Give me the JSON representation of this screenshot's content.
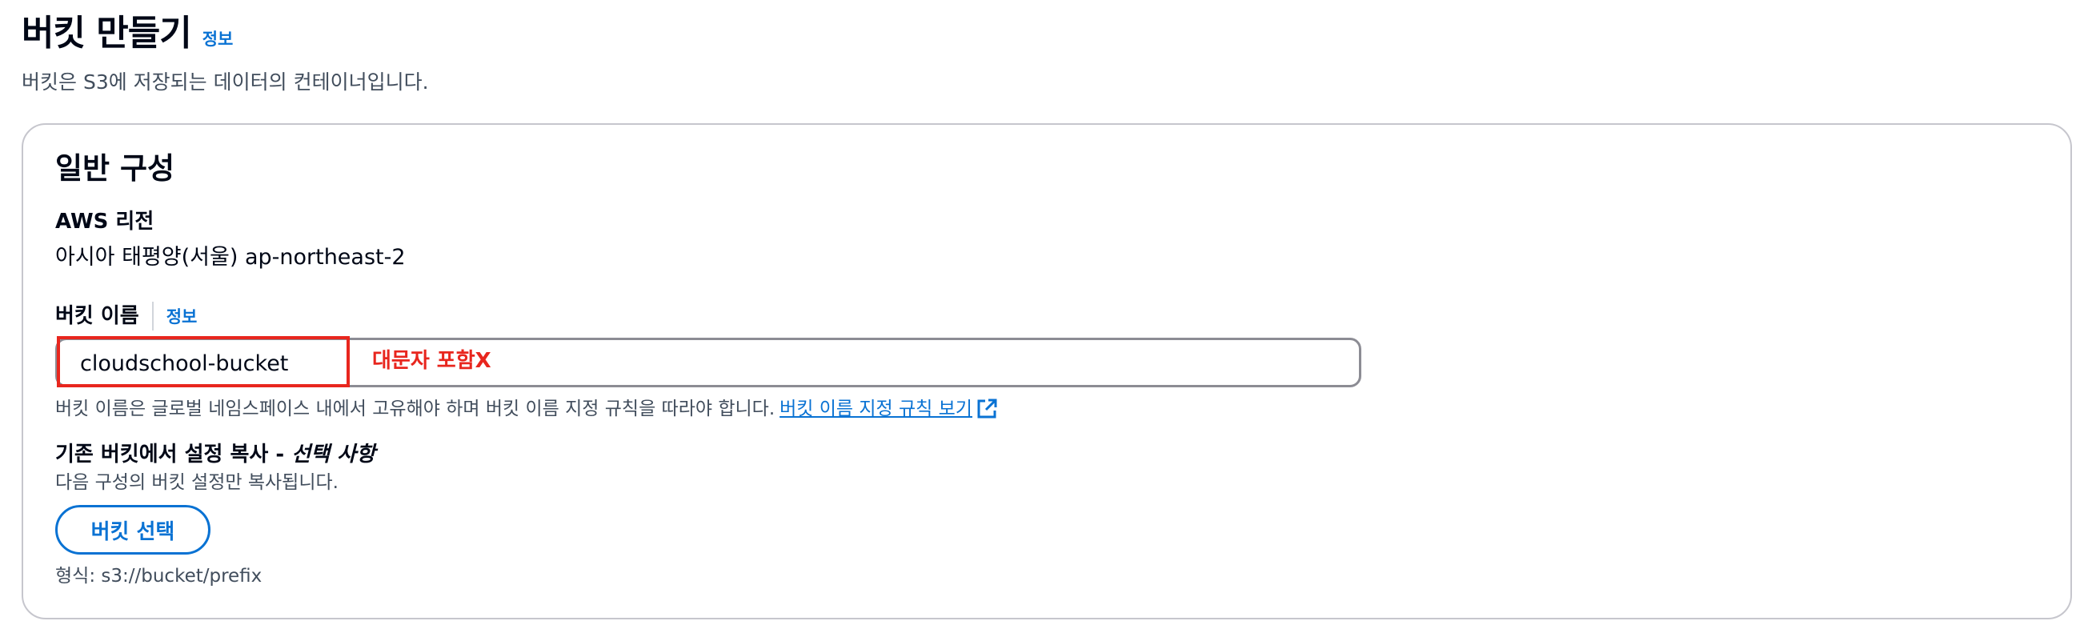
{
  "header": {
    "title": "버킷 만들기",
    "info_link": "정보",
    "description": "버킷은 S3에 저장되는 데이터의 컨테이너입니다."
  },
  "general": {
    "title": "일반 구성",
    "region_label": "AWS 리전",
    "region_value": "아시아 태평양(서울) ap-northeast-2",
    "bucket_name_label": "버킷 이름",
    "bucket_name_info": "정보",
    "bucket_name_value": "cloudschool-bucket",
    "annotation": "대문자 포함X",
    "bucket_name_hint": "버킷 이름은 글로벌 네임스페이스 내에서 고유해야 하며 버킷 이름 지정 규칙을 따라야 합니다.",
    "naming_rules_link": "버킷 이름 지정 규칙 보기",
    "copy_label": "기존 버킷에서 설정 복사 -",
    "copy_optional": "선택 사항",
    "copy_description": "다음 구성의 버킷 설정만 복사됩니다.",
    "choose_bucket_button": "버킷 선택",
    "format_hint": "형식: s3://bucket/prefix"
  },
  "colors": {
    "accent": "#0972d3",
    "annotation": "#e8261e",
    "text": "#000716",
    "secondary_text": "#414d5c",
    "border": "#c6c6cd"
  },
  "icons": {
    "external_link": "external-link-icon"
  }
}
